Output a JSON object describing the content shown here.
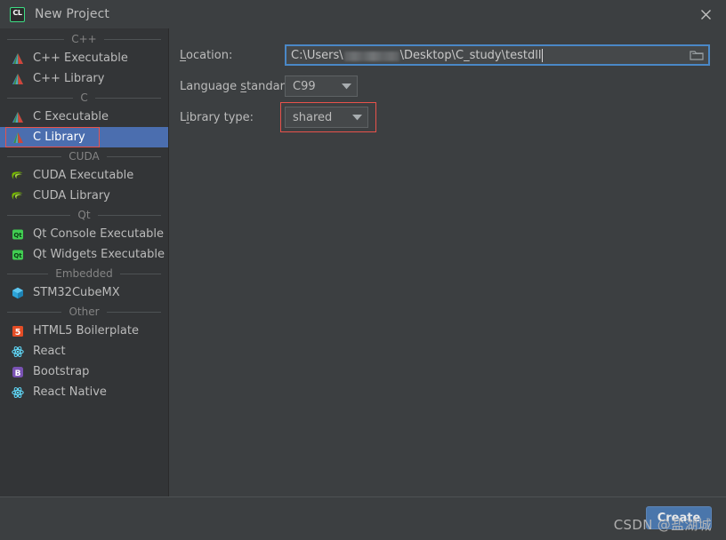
{
  "window": {
    "title": "New Project",
    "app_icon": "clion-icon",
    "app_icon_text": "CL",
    "close_label": "✕"
  },
  "sidebar": {
    "groups": [
      {
        "name": "C++",
        "items": [
          {
            "label": "C++ Executable",
            "icon": "clion-target-icon",
            "selected": false
          },
          {
            "label": "C++ Library",
            "icon": "clion-target-icon",
            "selected": false
          }
        ]
      },
      {
        "name": "C",
        "items": [
          {
            "label": "C Executable",
            "icon": "clion-target-icon",
            "selected": false
          },
          {
            "label": "C Library",
            "icon": "clion-target-icon",
            "selected": true
          }
        ]
      },
      {
        "name": "CUDA",
        "items": [
          {
            "label": "CUDA Executable",
            "icon": "nvidia-icon",
            "selected": false
          },
          {
            "label": "CUDA Library",
            "icon": "nvidia-icon",
            "selected": false
          }
        ]
      },
      {
        "name": "Qt",
        "items": [
          {
            "label": "Qt Console Executable",
            "icon": "qt-icon",
            "selected": false
          },
          {
            "label": "Qt Widgets Executable",
            "icon": "qt-icon",
            "selected": false
          }
        ]
      },
      {
        "name": "Embedded",
        "items": [
          {
            "label": "STM32CubeMX",
            "icon": "stm32cube-icon",
            "selected": false
          }
        ]
      },
      {
        "name": "Other",
        "items": [
          {
            "label": "HTML5 Boilerplate",
            "icon": "html5-icon",
            "selected": false
          },
          {
            "label": "React",
            "icon": "react-icon",
            "selected": false
          },
          {
            "label": "Bootstrap",
            "icon": "bootstrap-icon",
            "selected": false
          },
          {
            "label": "React Native",
            "icon": "react-icon",
            "selected": false
          }
        ]
      }
    ]
  },
  "form": {
    "location": {
      "label_prefix": "",
      "label_mnemonic": "L",
      "label_suffix": "ocation:",
      "value_before_blur": "C:\\Users\\",
      "value_after_blur": "\\Desktop\\C_study\\testdll",
      "redacted": true
    },
    "language_standard": {
      "label_prefix": "Language ",
      "label_mnemonic": "s",
      "label_suffix": "tandard:",
      "value": "C99"
    },
    "library_type": {
      "label_prefix": "L",
      "label_mnemonic": "i",
      "label_suffix": "brary type:",
      "value": "shared",
      "highlighted": true
    }
  },
  "footer": {
    "create_label": "Create",
    "watermark": "CSDN @盐湖城"
  },
  "colors": {
    "dialog_bg": "#3c3f41",
    "sidebar_bg": "#333537",
    "selection_blue": "#4b6eaf",
    "focus_border": "#4a88c7",
    "annotation_red": "#e8524b",
    "button_blue": "#4a76ab",
    "text": "#bbbbbb"
  }
}
